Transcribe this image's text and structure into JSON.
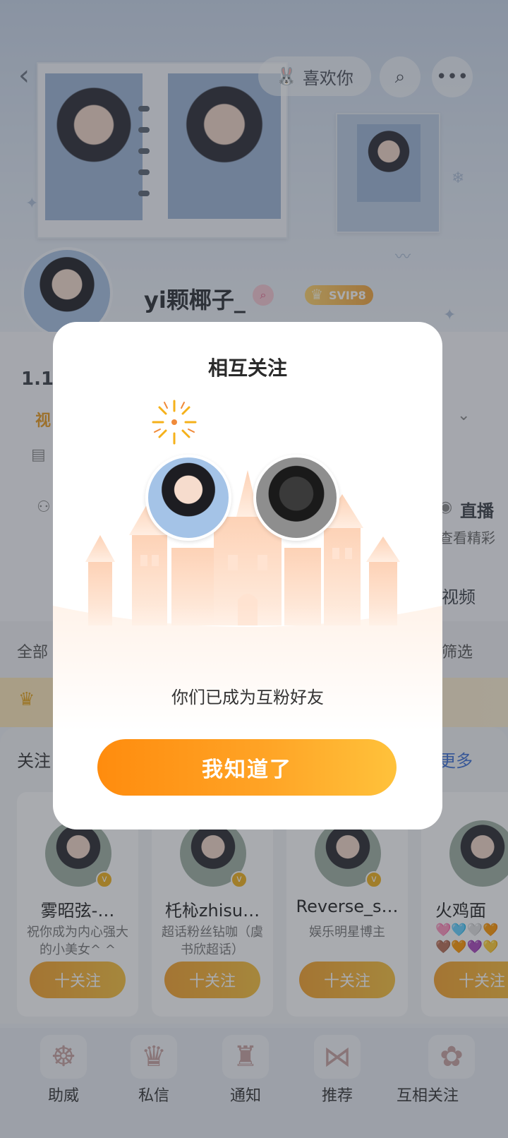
{
  "profile": {
    "header": {
      "like_label": "喜欢你"
    },
    "nickname": "yi颗椰子_",
    "vip_badge": "SVIP8",
    "fans_count_partial": "1.1万",
    "tab_partial": "视",
    "right_labels": {
      "live": "直播",
      "live_sub": "查看精彩",
      "video": "视频",
      "filter": "筛选"
    },
    "left_labels": {
      "all": "全部"
    }
  },
  "recommendations": {
    "title": "关注",
    "more": "更多",
    "follow_label": "十关注",
    "cards": [
      {
        "name": "雾昭弦-…",
        "desc": "祝你成为内心强大的小美女^ ^"
      },
      {
        "name": "杔杺zhisu…",
        "desc": "超话粉丝钻咖（虞书欣超话）"
      },
      {
        "name": "Reverse_s…",
        "desc": "娱乐明星博主"
      },
      {
        "name": "火鸡面",
        "desc": "🩷🩵🤍🧡🤎🧡💜💛"
      }
    ]
  },
  "bottom_nav": {
    "items": [
      {
        "label": "助威"
      },
      {
        "label": "私信"
      },
      {
        "label": "通知"
      },
      {
        "label": "推荐"
      },
      {
        "label": "互相关注"
      }
    ]
  },
  "dialog": {
    "title": "相互关注",
    "message": "你们已成为互粉好友",
    "confirm_button": "我知道了"
  },
  "colors": {
    "accent_orange": "#ff8c0e",
    "accent_yellow": "#ffc23b",
    "link_blue": "#3b6fd6"
  }
}
